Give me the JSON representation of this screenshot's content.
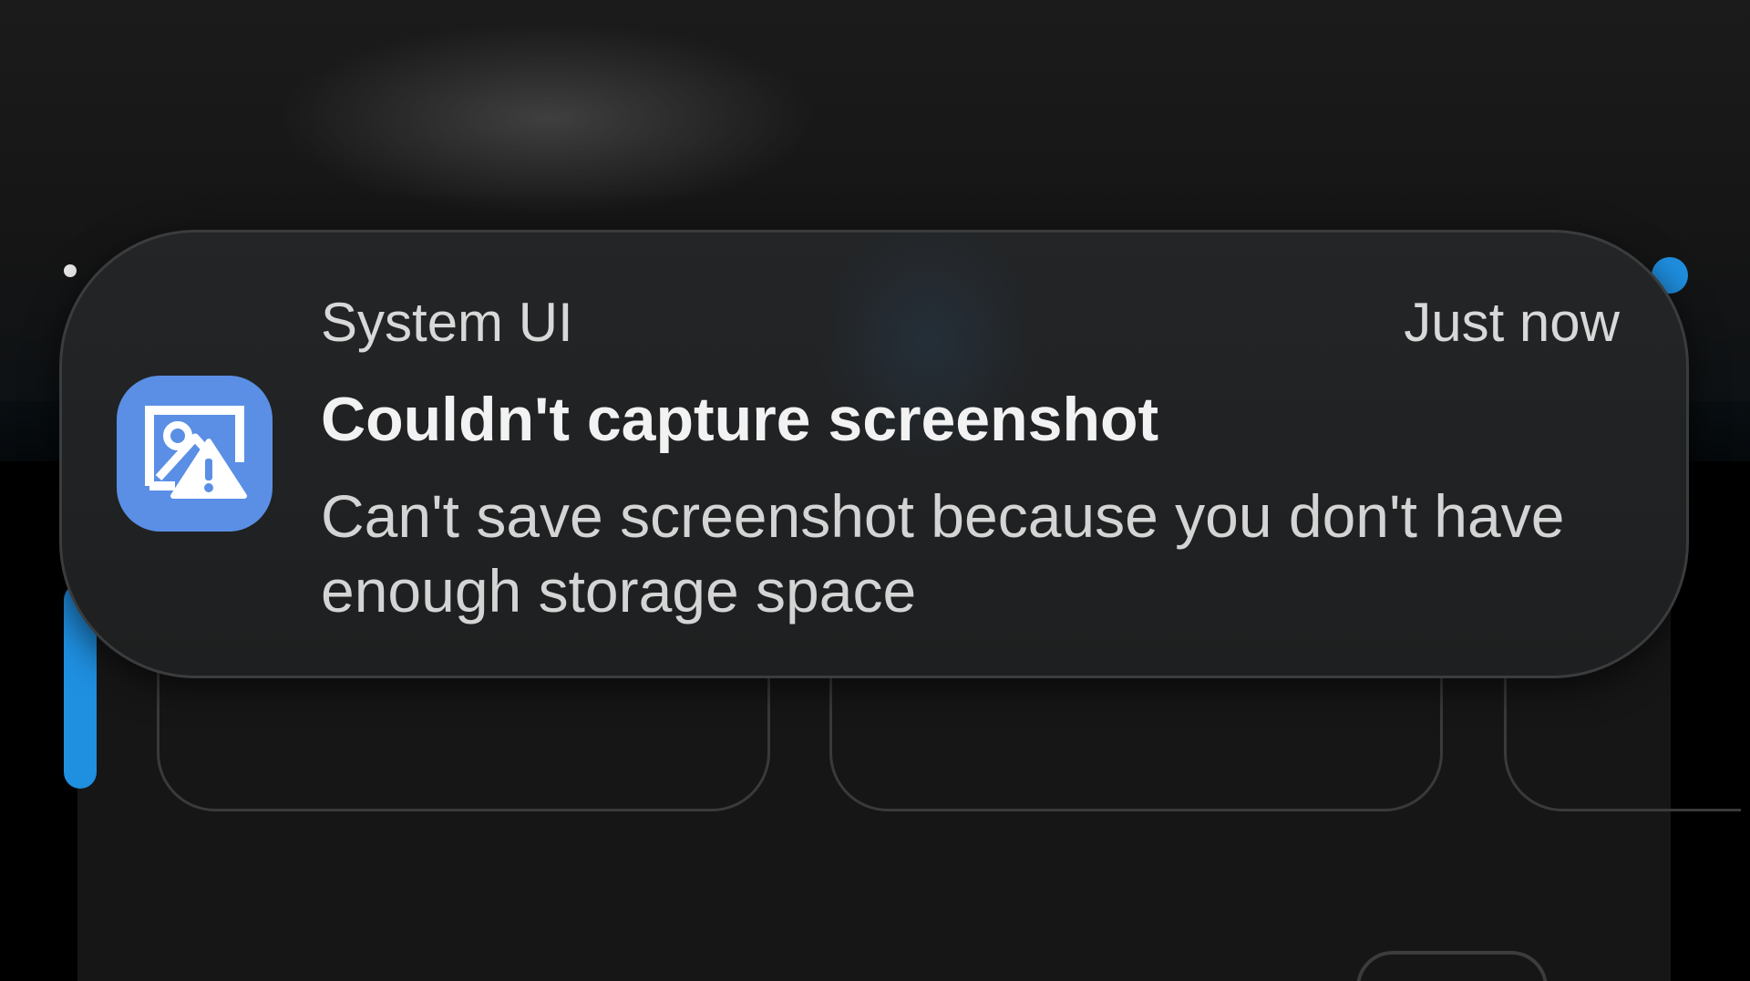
{
  "notification": {
    "app_name": "System UI",
    "timestamp": "Just now",
    "title": "Couldn't capture screenshot",
    "body": "Can't save screenshot because you don't have enough storage space",
    "icon": "screenshot-error-icon"
  },
  "colors": {
    "icon_background": "#5a8fe5",
    "accent_blue": "#1f8fe0",
    "card_background": "#1f2021",
    "title_text": "#f2f2f2",
    "secondary_text": "#d4d4d4"
  }
}
